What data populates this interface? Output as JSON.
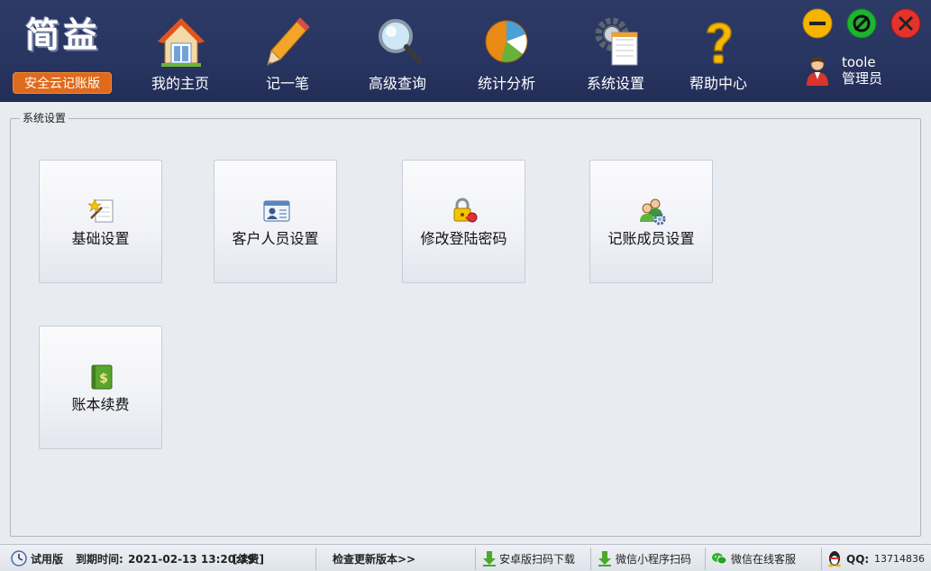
{
  "app": {
    "logo_title": "简益",
    "logo_subtitle": "安全云记账版"
  },
  "nav": [
    {
      "label": "我的主页",
      "icon": "home-icon"
    },
    {
      "label": "记一笔",
      "icon": "pencil-icon"
    },
    {
      "label": "高级查询",
      "icon": "magnifier-icon"
    },
    {
      "label": "统计分析",
      "icon": "pie-chart-icon"
    },
    {
      "label": "系统设置",
      "icon": "gear-document-icon"
    },
    {
      "label": "帮助中心",
      "icon": "question-icon"
    }
  ],
  "user": {
    "name": "toole",
    "role": "管理员"
  },
  "window": {
    "minimize_color": "#f5b400",
    "maximize_color": "#1fb233",
    "close_color": "#e5322d"
  },
  "group": {
    "title": "系统设置",
    "tiles": [
      {
        "label": "基础设置",
        "icon": "settings-wand-icon"
      },
      {
        "label": "客户人员设置",
        "icon": "contact-card-icon"
      },
      {
        "label": "修改登陆密码",
        "icon": "lock-key-icon"
      },
      {
        "label": "记账成员设置",
        "icon": "users-gear-icon"
      },
      {
        "label": "账本续费",
        "icon": "money-book-icon"
      }
    ]
  },
  "status": {
    "trial": "试用版",
    "expire_label": "到期时间:",
    "expire_value": "2021-02-13 13:20:39",
    "renew": "[续费]",
    "check_update": "检查更新版本>>",
    "android": "安卓版扫码下载",
    "wechat_mini": "微信小程序扫码",
    "wechat_service": "微信在线客服",
    "qq_label": "QQ:",
    "qq_value": "13714836"
  }
}
